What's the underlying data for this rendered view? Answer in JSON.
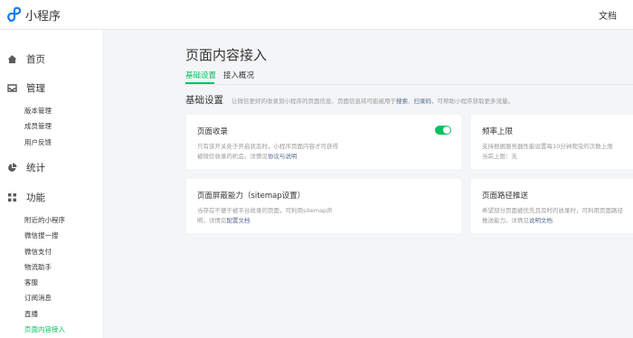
{
  "brand": {
    "name": "小程序",
    "color": "#07c160",
    "link_color": "#576b95"
  },
  "header": {
    "docs_label": "文档"
  },
  "sidebar": {
    "main": [
      {
        "label": "首页",
        "icon": "home-icon"
      },
      {
        "label": "管理",
        "icon": "inbox-icon"
      },
      {
        "label": "统计",
        "icon": "pie-chart-icon"
      },
      {
        "label": "功能",
        "icon": "grid-icon"
      }
    ],
    "manage_items": [
      "版本管理",
      "成员管理",
      "用户反馈"
    ],
    "feature_items": [
      "附近的小程序",
      "微信搜一搜",
      "微信支付",
      "物流助手",
      "客服",
      "订阅消息",
      "直播",
      "页面内容接入"
    ],
    "active_item": "页面内容接入"
  },
  "main": {
    "title": "页面内容接入",
    "tabs": [
      {
        "label": "基础设置",
        "active": true
      },
      {
        "label": "接入概况",
        "active": false
      }
    ],
    "section": {
      "title": "基础设置",
      "desc_prefix": "让微信更好的收录到小程序的页面信息，页面信息将可能被用于",
      "desc_link1": "搜索",
      "desc_sep": "、",
      "desc_link2": "扫录码",
      "desc_suffix": "，可帮助小程序获取更多流量。"
    },
    "cards": {
      "page_indexing": {
        "title": "页面收录",
        "desc_line1": "只有该开关处于开启状态时，小程序页面内容才可获得",
        "desc_line2": "被微信收录的机会。详情见",
        "link": "协议与说明",
        "toggle_on": true
      },
      "frequency": {
        "title": "频率上限",
        "desc_line1": "支持根据服务器性能设置每10分钟爬虫的次数上限",
        "desc_line2": "当前上限：无"
      },
      "screen_capability": {
        "title": "页面屏蔽能力（sitemap设置）",
        "desc_line1": "当存在不便于被平台收录的页面，可利用sitemap声",
        "desc_line2": "明，详情见",
        "link": "配置文档"
      },
      "path_push": {
        "title": "页面路径推送",
        "desc_line1": "希望部分页面被优先且及时的收录时，可利用页面路径",
        "desc_line2": "推送能力。详情见",
        "link": "说明文档"
      }
    }
  }
}
